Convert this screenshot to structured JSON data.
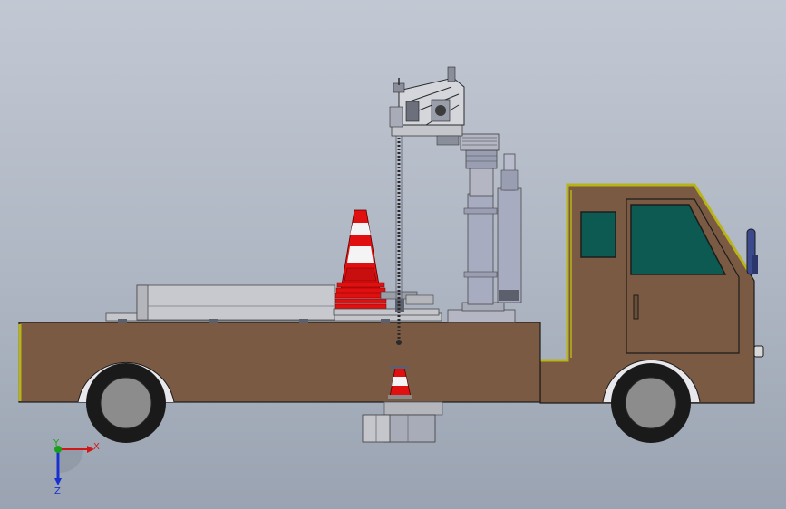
{
  "axes": {
    "x_label": "X",
    "y_label": "Y",
    "z_label": "Z",
    "x_color": "#d01818",
    "y_color": "#18a018",
    "z_color": "#1830d0"
  },
  "colors": {
    "truck_body": "#7a5a42",
    "truck_trim": "#b8b418",
    "window": "#0d5a52",
    "cone_red": "#e01010",
    "cone_white": "#f4f4f4",
    "metal": "#a8acb8",
    "metal_dark": "#5c606c",
    "tire": "#1a1a1a",
    "rim": "#8c8c8c"
  }
}
